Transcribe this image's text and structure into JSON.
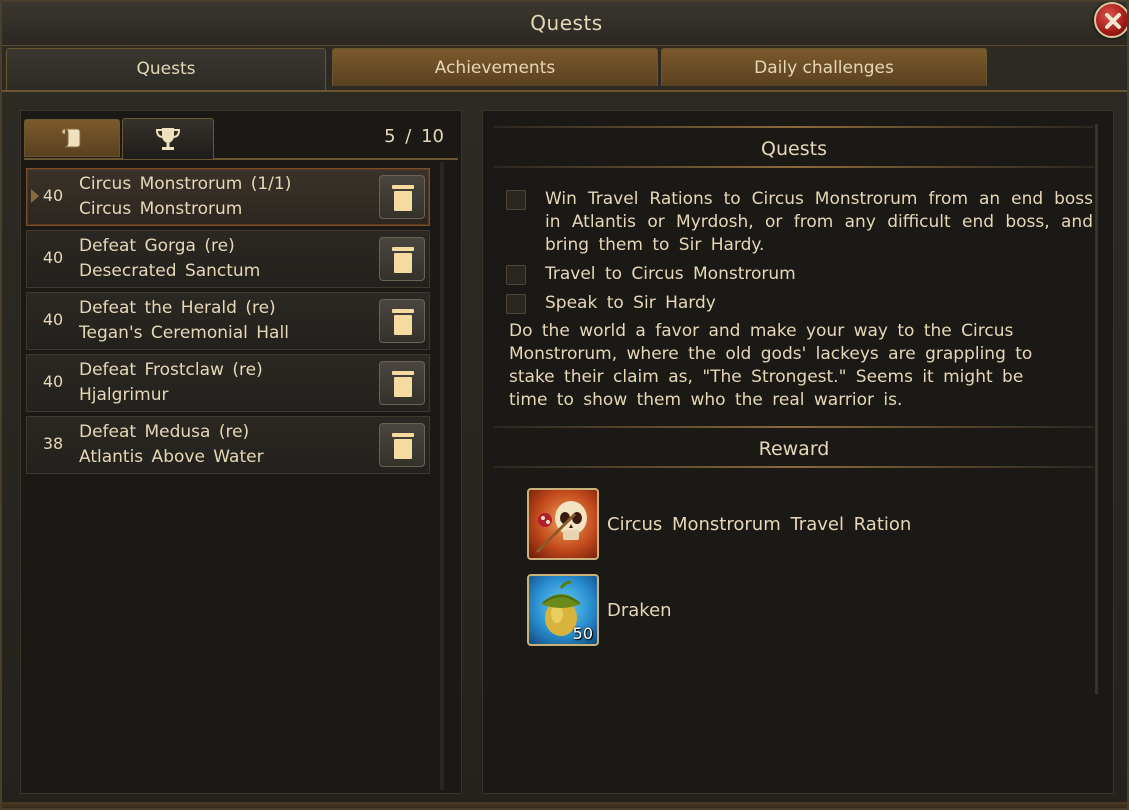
{
  "window": {
    "title": "Quests",
    "close_icon": "close-x-icon"
  },
  "tabs": [
    {
      "label": "Quests",
      "active": true
    },
    {
      "label": "Achievements",
      "active": false
    },
    {
      "label": "Daily  challenges",
      "active": false
    }
  ],
  "left": {
    "subtabs": [
      {
        "icon": "scroll-icon",
        "active": false
      },
      {
        "icon": "trophy-icon",
        "active": true
      }
    ],
    "count": "5 / 10",
    "quests": [
      {
        "level": "40",
        "name": "Circus Monstrorum (1/1)",
        "location": "Circus Monstrorum",
        "selected": true
      },
      {
        "level": "40",
        "name": "Defeat Gorga (re)",
        "location": "Desecrated Sanctum",
        "selected": false
      },
      {
        "level": "40",
        "name": "Defeat the Herald (re)",
        "location": "Tegan's Ceremonial Hall",
        "selected": false
      },
      {
        "level": "40",
        "name": "Defeat Frostclaw (re)",
        "location": "Hjalgrimur",
        "selected": false
      },
      {
        "level": "38",
        "name": "Defeat Medusa (re)",
        "location": "Atlantis Above Water",
        "selected": false
      }
    ]
  },
  "detail": {
    "quests_header": "Quests",
    "tasks": [
      "Win Travel Rations to Circus Monstrorum from an end boss in Atlantis or Myrdosh, or from any difficult end boss, and bring them to Sir Hardy.",
      "Travel to Circus Monstrorum",
      "Speak to Sir Hardy"
    ],
    "description": "Do the world a favor and make your way to the Circus Monstrorum, where the old gods' lackeys are grappling to stake their claim as, \"The Strongest.\"  Seems it might be time to show them who the real warrior is.",
    "reward_header": "Reward",
    "rewards": [
      {
        "label": "Circus Monstrorum Travel Ration",
        "icon": "skull-ration-icon",
        "count": ""
      },
      {
        "label": "Draken",
        "icon": "acorn-icon",
        "count": "50"
      }
    ]
  }
}
